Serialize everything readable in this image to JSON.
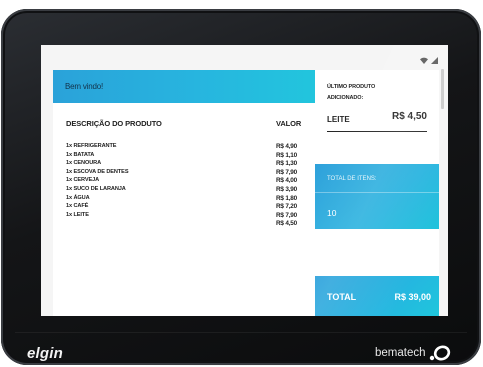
{
  "app": {
    "welcome_text": "Bem vindo!"
  },
  "items_table": {
    "header_description": "DESCRIÇÃO DO PRODUTO",
    "header_value": "VALOR",
    "rows": [
      {
        "desc": "1x REFRIGERANTE",
        "val": "R$ 4,90"
      },
      {
        "desc": "1x BATATA",
        "val": "R$ 1,10"
      },
      {
        "desc": "1x CENOURA",
        "val": "R$ 1,30"
      },
      {
        "desc": "1x ESCOVA DE DENTES",
        "val": "R$ 7,90"
      },
      {
        "desc": "1x CERVEJA",
        "val": "R$ 4,00"
      },
      {
        "desc": "1x SUCO DE LARANJA",
        "val": "R$ 3,90"
      },
      {
        "desc": "1x ÁGUA",
        "val": "R$ 1,80"
      },
      {
        "desc": "1x CAFÉ",
        "val": "R$ 7,20"
      },
      {
        "desc": "1x LEITE",
        "val": "R$ 7,90"
      },
      {
        "desc": "",
        "val": "R$ 4,50"
      }
    ]
  },
  "last_product": {
    "title_line1": "ÚLTIMO PRODUTO",
    "title_line2": "ADICIONADO:",
    "name": "LEITE",
    "price": "R$ 4,50"
  },
  "items_count": {
    "label": "TOTAL DE ITENS:",
    "value": "10"
  },
  "total": {
    "label": "TOTAL",
    "value": "R$ 39,00"
  },
  "device": {
    "brand_left": "elgin",
    "brand_right": "bematech"
  },
  "colors": {
    "accent": "#27b3df",
    "accent_dark": "#2a9fdb",
    "bezel": "#141517"
  },
  "icons": [
    "wifi-icon",
    "signal-icon",
    "bematech-logo-icon"
  ]
}
